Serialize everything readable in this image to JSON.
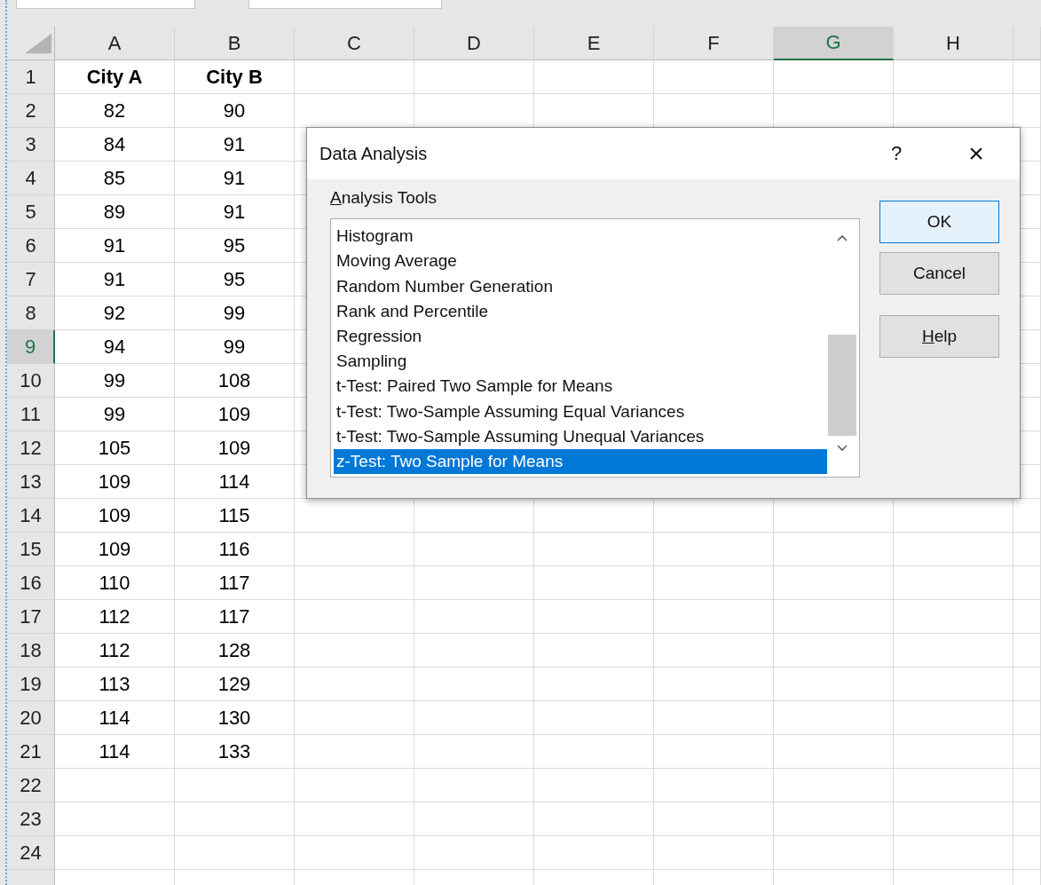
{
  "columns": [
    {
      "label": "A",
      "selected": false
    },
    {
      "label": "B",
      "selected": false
    },
    {
      "label": "C",
      "selected": false
    },
    {
      "label": "D",
      "selected": false
    },
    {
      "label": "E",
      "selected": false
    },
    {
      "label": "F",
      "selected": false
    },
    {
      "label": "G",
      "selected": true
    },
    {
      "label": "H",
      "selected": false
    }
  ],
  "rows": [
    {
      "number": "1",
      "selected": false,
      "kind": "header",
      "cells": [
        "City A",
        "City B"
      ]
    },
    {
      "number": "2",
      "selected": false,
      "kind": "data",
      "cells": [
        "82",
        "90"
      ]
    },
    {
      "number": "3",
      "selected": false,
      "kind": "data",
      "cells": [
        "84",
        "91"
      ]
    },
    {
      "number": "4",
      "selected": false,
      "kind": "data",
      "cells": [
        "85",
        "91"
      ]
    },
    {
      "number": "5",
      "selected": false,
      "kind": "data",
      "cells": [
        "89",
        "91"
      ]
    },
    {
      "number": "6",
      "selected": false,
      "kind": "data",
      "cells": [
        "91",
        "95"
      ]
    },
    {
      "number": "7",
      "selected": false,
      "kind": "data",
      "cells": [
        "91",
        "95"
      ]
    },
    {
      "number": "8",
      "selected": false,
      "kind": "data",
      "cells": [
        "92",
        "99"
      ]
    },
    {
      "number": "9",
      "selected": true,
      "kind": "data",
      "cells": [
        "94",
        "99"
      ]
    },
    {
      "number": "10",
      "selected": false,
      "kind": "data",
      "cells": [
        "99",
        "108"
      ]
    },
    {
      "number": "11",
      "selected": false,
      "kind": "data",
      "cells": [
        "99",
        "109"
      ]
    },
    {
      "number": "12",
      "selected": false,
      "kind": "data",
      "cells": [
        "105",
        "109"
      ]
    },
    {
      "number": "13",
      "selected": false,
      "kind": "data",
      "cells": [
        "109",
        "114"
      ]
    },
    {
      "number": "14",
      "selected": false,
      "kind": "data",
      "cells": [
        "109",
        "115"
      ]
    },
    {
      "number": "15",
      "selected": false,
      "kind": "data",
      "cells": [
        "109",
        "116"
      ]
    },
    {
      "number": "16",
      "selected": false,
      "kind": "data",
      "cells": [
        "110",
        "117"
      ]
    },
    {
      "number": "17",
      "selected": false,
      "kind": "data",
      "cells": [
        "112",
        "117"
      ]
    },
    {
      "number": "18",
      "selected": false,
      "kind": "data",
      "cells": [
        "112",
        "128"
      ]
    },
    {
      "number": "19",
      "selected": false,
      "kind": "data",
      "cells": [
        "113",
        "129"
      ]
    },
    {
      "number": "20",
      "selected": false,
      "kind": "data",
      "cells": [
        "114",
        "130"
      ]
    },
    {
      "number": "21",
      "selected": false,
      "kind": "data",
      "cells": [
        "114",
        "133"
      ]
    },
    {
      "number": "22",
      "selected": false
    },
    {
      "number": "23",
      "selected": false
    },
    {
      "number": "24",
      "selected": false
    }
  ],
  "dialog": {
    "title": "Data Analysis",
    "help": "?",
    "close": "×",
    "list_label": {
      "text": "Analysis Tools",
      "access_key_underlined": true
    },
    "tools": [
      {
        "label": "Histogram",
        "selected": false
      },
      {
        "label": "Moving Average",
        "selected": false
      },
      {
        "label": "Random Number Generation",
        "selected": false
      },
      {
        "label": "Rank and Percentile",
        "selected": false
      },
      {
        "label": "Regression",
        "selected": false
      },
      {
        "label": "Sampling",
        "selected": false
      },
      {
        "label": "t-Test: Paired Two Sample for Means",
        "selected": false
      },
      {
        "label": "t-Test: Two-Sample Assuming Equal Variances",
        "selected": false
      },
      {
        "label": "t-Test: Two-Sample Assuming Unequal Variances",
        "selected": false
      },
      {
        "label": "z-Test: Two Sample for Means",
        "selected": true
      }
    ],
    "buttons": [
      {
        "text": "OK",
        "kind": "default"
      },
      {
        "text": "Cancel",
        "kind": "normal"
      },
      {
        "text": "Help",
        "kind": "normal",
        "access_key_underlined": true
      }
    ]
  }
}
